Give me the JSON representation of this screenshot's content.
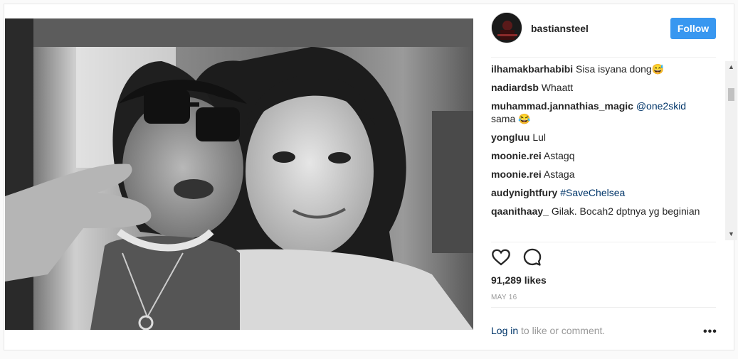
{
  "post": {
    "username": "bastiansteel",
    "follow_label": "Follow",
    "likes": "91,289 likes",
    "date": "MAY 16",
    "login_link": "Log in",
    "login_rest": " to like or comment.",
    "more": "•••"
  },
  "comments": [
    {
      "user": "ilhamakbarhabibi",
      "text": " Sisa isyana dong😅"
    },
    {
      "user": "nadiardsb",
      "text": " Whaatt"
    },
    {
      "user": "muhammad.jannathias_magic",
      "text": " ",
      "mention": "@one2skid",
      "text2": " sama 😂"
    },
    {
      "user": "yongluu",
      "text": " Lul"
    },
    {
      "user": "moonie.rei",
      "text": " Astagq"
    },
    {
      "user": "moonie.rei",
      "text": " Astaga"
    },
    {
      "user": "audynightfury",
      "text": " ",
      "mention": "#SaveChelsea"
    },
    {
      "user": "qaanithaay_",
      "text": " Gilak. Bocah2 dptnya yg beginian"
    }
  ],
  "icons": {
    "like": "heart-icon",
    "comment": "comment-icon",
    "scroll_up": "scroll-up-arrow",
    "scroll_down": "scroll-down-arrow"
  },
  "colors": {
    "follow_bg": "#3897f0",
    "link": "#003569",
    "muted": "#999999",
    "border": "#e6e6e6"
  }
}
